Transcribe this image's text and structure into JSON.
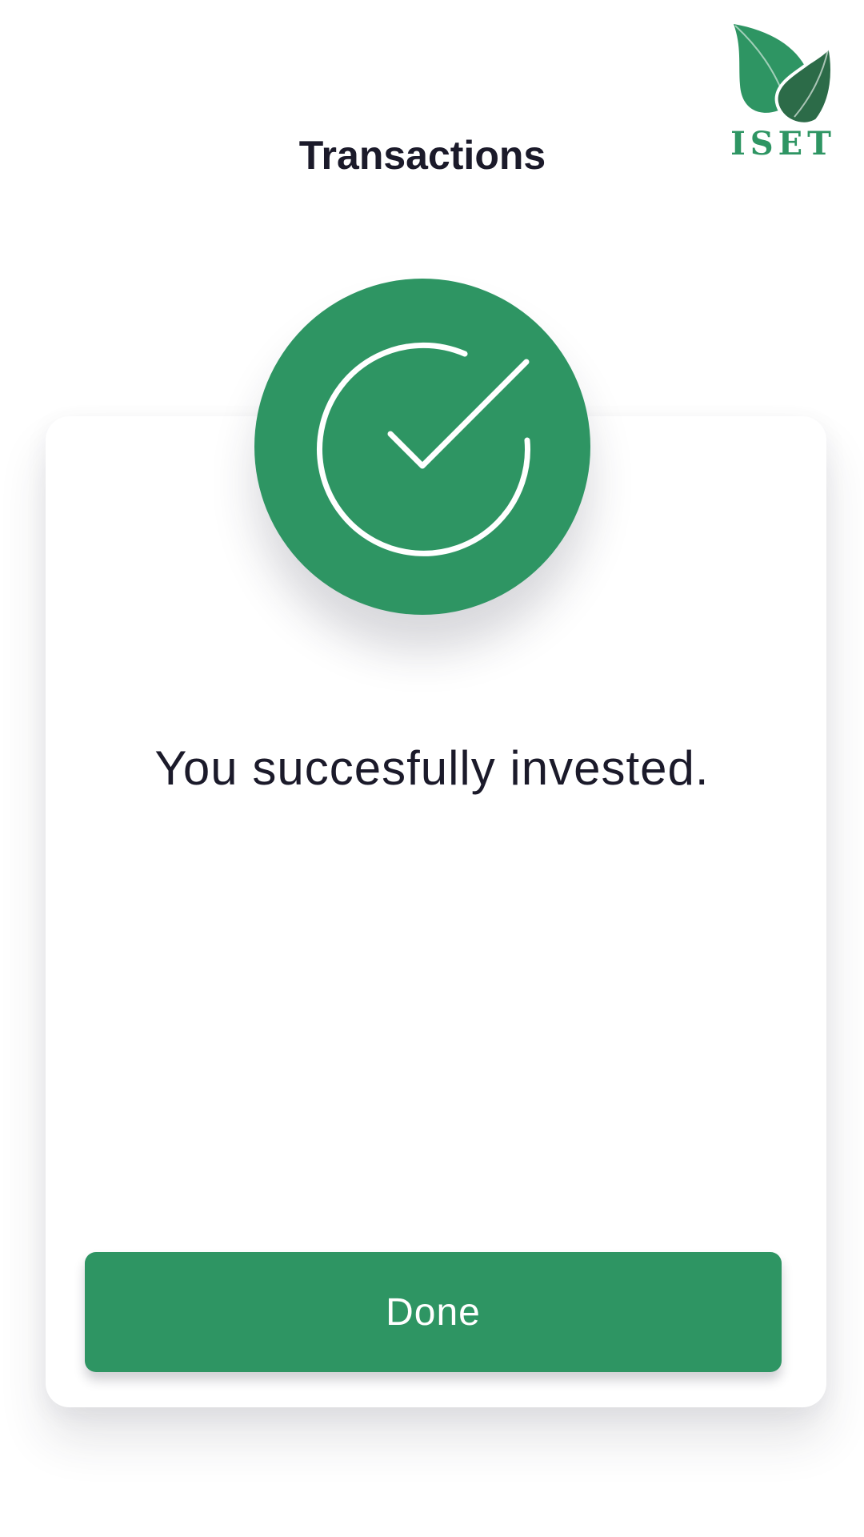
{
  "header": {
    "title": "Transactions"
  },
  "logo": {
    "text": "ISET",
    "icon": "leaves-icon"
  },
  "success": {
    "icon": "check-circle-icon",
    "message": "You succesfully invested."
  },
  "actions": {
    "done_label": "Done"
  },
  "colors": {
    "brand_green": "#2e9563",
    "dark_green": "#2c6b48",
    "text_dark": "#1b1a2a",
    "background": "#ffffff"
  }
}
